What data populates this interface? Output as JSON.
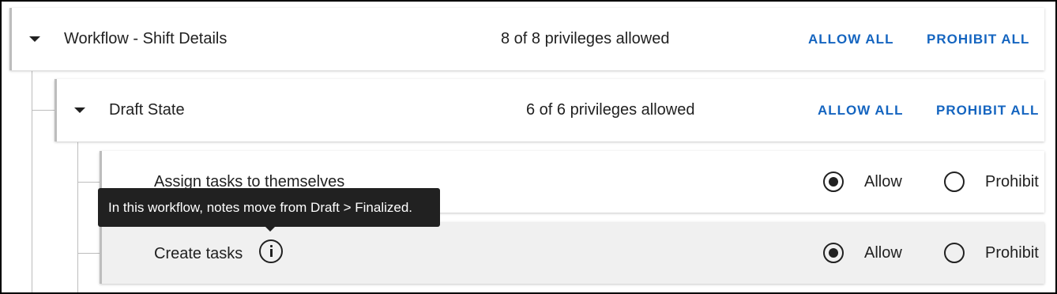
{
  "workflow": {
    "title": "Workflow - Shift Details",
    "count": "8 of 8 privileges allowed",
    "allow_all": "ALLOW ALL",
    "prohibit_all": "PROHIBIT ALL"
  },
  "state": {
    "title": "Draft State",
    "count": "6 of 6 privileges allowed",
    "allow_all": "ALLOW ALL",
    "prohibit_all": "PROHIBIT ALL"
  },
  "privileges": [
    {
      "label": "Assign tasks to themselves",
      "allow": "Allow",
      "prohibit": "Prohibit",
      "selected": "allow"
    },
    {
      "label": "Create tasks",
      "allow": "Allow",
      "prohibit": "Prohibit",
      "selected": "allow",
      "icon": "info-icon"
    }
  ],
  "tooltip": {
    "text": "In this workflow, notes move from Draft > Finalized."
  },
  "colors": {
    "accent": "#1565c0",
    "hover_row": "#f0f0f0",
    "tooltip_bg": "#212121"
  }
}
